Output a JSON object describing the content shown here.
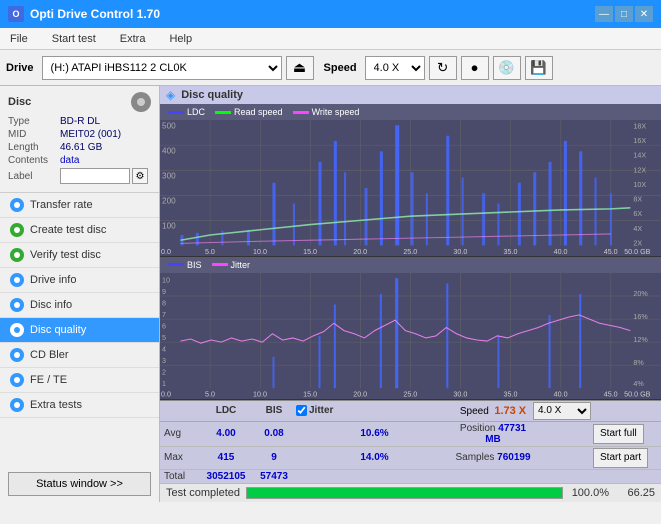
{
  "app": {
    "title": "Opti Drive Control 1.70",
    "icon_label": "O"
  },
  "title_bar": {
    "title": "Opti Drive Control 1.70",
    "minimize": "—",
    "maximize": "□",
    "close": "✕"
  },
  "menu": {
    "items": [
      "File",
      "Start test",
      "Extra",
      "Help"
    ]
  },
  "drive_toolbar": {
    "drive_label": "Drive",
    "drive_value": "(H:)  ATAPI iHBS112  2 CL0K",
    "speed_label": "Speed",
    "speed_value": "4.0 X"
  },
  "disc": {
    "title": "Disc",
    "type_label": "Type",
    "type_value": "BD-R DL",
    "mid_label": "MID",
    "mid_value": "MEIT02 (001)",
    "length_label": "Length",
    "length_value": "46.61 GB",
    "contents_label": "Contents",
    "contents_value": "data",
    "label_label": "Label",
    "label_value": ""
  },
  "nav_items": [
    {
      "id": "transfer-rate",
      "label": "Transfer rate",
      "active": false
    },
    {
      "id": "create-test-disc",
      "label": "Create test disc",
      "active": false
    },
    {
      "id": "verify-test-disc",
      "label": "Verify test disc",
      "active": false
    },
    {
      "id": "drive-info",
      "label": "Drive info",
      "active": false
    },
    {
      "id": "disc-info",
      "label": "Disc info",
      "active": false
    },
    {
      "id": "disc-quality",
      "label": "Disc quality",
      "active": true
    },
    {
      "id": "cd-bler",
      "label": "CD Bler",
      "active": false
    },
    {
      "id": "fe-te",
      "label": "FE / TE",
      "active": false
    },
    {
      "id": "extra-tests",
      "label": "Extra tests",
      "active": false
    }
  ],
  "status_btn": "Status window >>",
  "chart": {
    "title": "Disc quality",
    "legend1": {
      "ldc": "LDC",
      "read": "Read speed",
      "write": "Write speed"
    },
    "legend2": {
      "bis": "BIS",
      "jitter": "Jitter"
    },
    "x_labels": [
      "0.0",
      "5.0",
      "10.0",
      "15.0",
      "20.0",
      "25.0",
      "30.0",
      "35.0",
      "40.0",
      "45.0",
      "50.0 GB"
    ],
    "y1_left": [
      "500",
      "400",
      "300",
      "200",
      "100"
    ],
    "y1_right": [
      "18X",
      "16X",
      "14X",
      "12X",
      "10X",
      "8X",
      "6X",
      "4X",
      "2X"
    ],
    "y2_left": [
      "10",
      "9",
      "8",
      "7",
      "6",
      "5",
      "4",
      "3",
      "2",
      "1"
    ],
    "y2_right": [
      "20%",
      "16%",
      "12%",
      "8%",
      "4%"
    ]
  },
  "stats": {
    "headers": [
      "",
      "LDC",
      "BIS",
      "",
      "Jitter",
      "Speed",
      "",
      ""
    ],
    "avg_label": "Avg",
    "avg_ldc": "4.00",
    "avg_bis": "0.08",
    "avg_jitter": "10.6%",
    "max_label": "Max",
    "max_ldc": "415",
    "max_bis": "9",
    "max_jitter": "14.0%",
    "total_label": "Total",
    "total_ldc": "3052105",
    "total_bis": "57473",
    "speed_label": "Speed",
    "speed_value": "1.73 X",
    "speed_select": "4.0 X",
    "position_label": "Position",
    "position_value": "47731 MB",
    "samples_label": "Samples",
    "samples_value": "760199",
    "jitter_checked": true,
    "jitter_label": "Jitter",
    "start_full": "Start full",
    "start_part": "Start part"
  },
  "progress": {
    "status": "Test completed",
    "percent": 100,
    "percent_display": "100.0%",
    "value": "66.25"
  }
}
